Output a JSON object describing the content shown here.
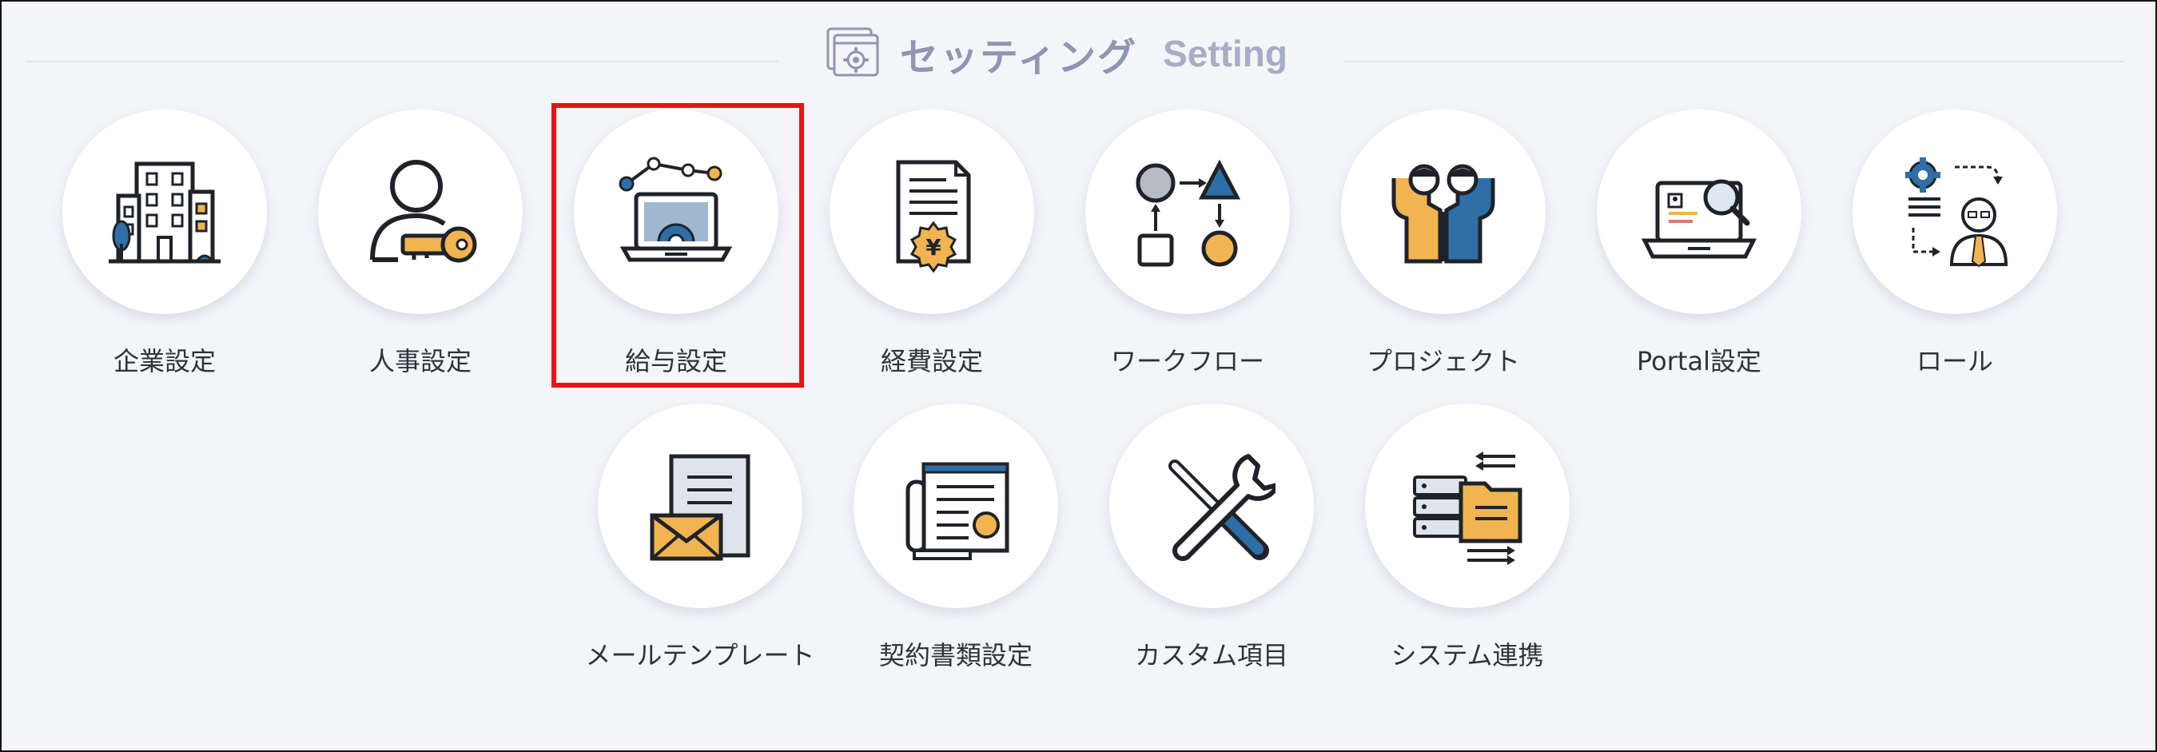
{
  "header": {
    "title_jp": "セッティング",
    "title_en": "Setting",
    "icon": "settings-window-gear-icon"
  },
  "tiles": [
    {
      "label": "企業設定",
      "icon": "office-building-icon"
    },
    {
      "label": "人事設定",
      "icon": "person-key-icon"
    },
    {
      "label": "給与設定",
      "icon": "laptop-gear-chart-icon"
    },
    {
      "label": "経費設定",
      "icon": "document-yen-icon"
    },
    {
      "label": "ワークフロー",
      "icon": "workflow-shapes-icon"
    },
    {
      "label": "プロジェクト",
      "icon": "team-people-icon"
    },
    {
      "label": "Portal設定",
      "icon": "laptop-search-icon"
    },
    {
      "label": "ロール",
      "icon": "role-person-gear-icon"
    },
    {
      "label": "メールテンプレート",
      "icon": "mail-document-icon"
    },
    {
      "label": "契約書類設定",
      "icon": "contract-documents-icon"
    },
    {
      "label": "カスタム項目",
      "icon": "wrench-screwdriver-icon"
    },
    {
      "label": "システム連携",
      "icon": "server-folder-sync-icon"
    }
  ],
  "highlight": {
    "target": "給与設定",
    "color": "#ee1111"
  },
  "colors": {
    "background": "#f3f5f9",
    "title": "#8e96b1",
    "icon_blue": "#2e6fa7",
    "icon_orange": "#f2b450",
    "icon_dark": "#1f2329"
  }
}
